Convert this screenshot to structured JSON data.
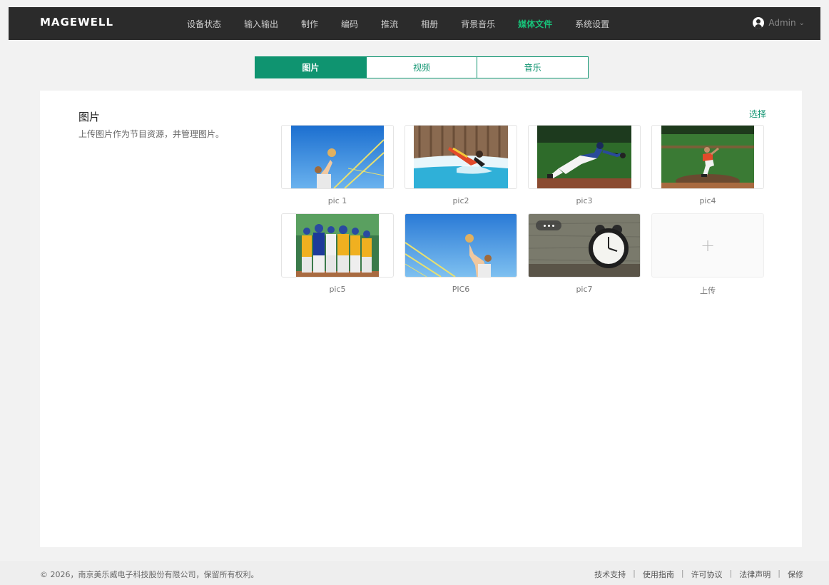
{
  "brand": "MAGEWELL",
  "nav": [
    {
      "label": "设备状态"
    },
    {
      "label": "输入输出"
    },
    {
      "label": "制作"
    },
    {
      "label": "编码"
    },
    {
      "label": "推流"
    },
    {
      "label": "相册"
    },
    {
      "label": "背景音乐"
    },
    {
      "label": "媒体文件",
      "active": true
    },
    {
      "label": "系统设置"
    }
  ],
  "user": {
    "name": "Admin"
  },
  "tabs": [
    {
      "label": "图片",
      "active": true
    },
    {
      "label": "视频"
    },
    {
      "label": "音乐"
    }
  ],
  "section": {
    "title": "图片",
    "description": "上传图片作为节目资源，并管理图片。",
    "select_label": "选择"
  },
  "images": [
    {
      "caption": "pic 1"
    },
    {
      "caption": "pic2"
    },
    {
      "caption": "pic3"
    },
    {
      "caption": "pic4"
    },
    {
      "caption": "pic5"
    },
    {
      "caption": "PIC6"
    },
    {
      "caption": "pic7"
    }
  ],
  "upload": {
    "caption": "上传"
  },
  "footer": {
    "copyright": "© 2026，南京美乐威电子科技股份有限公司，保留所有权利。",
    "links": [
      "技术支持",
      "使用指南",
      "许可协议",
      "法律声明",
      "保修"
    ]
  },
  "colors": {
    "accent": "#0f9470",
    "nav_active": "#18c37a",
    "topbar": "#2b2b2b"
  }
}
